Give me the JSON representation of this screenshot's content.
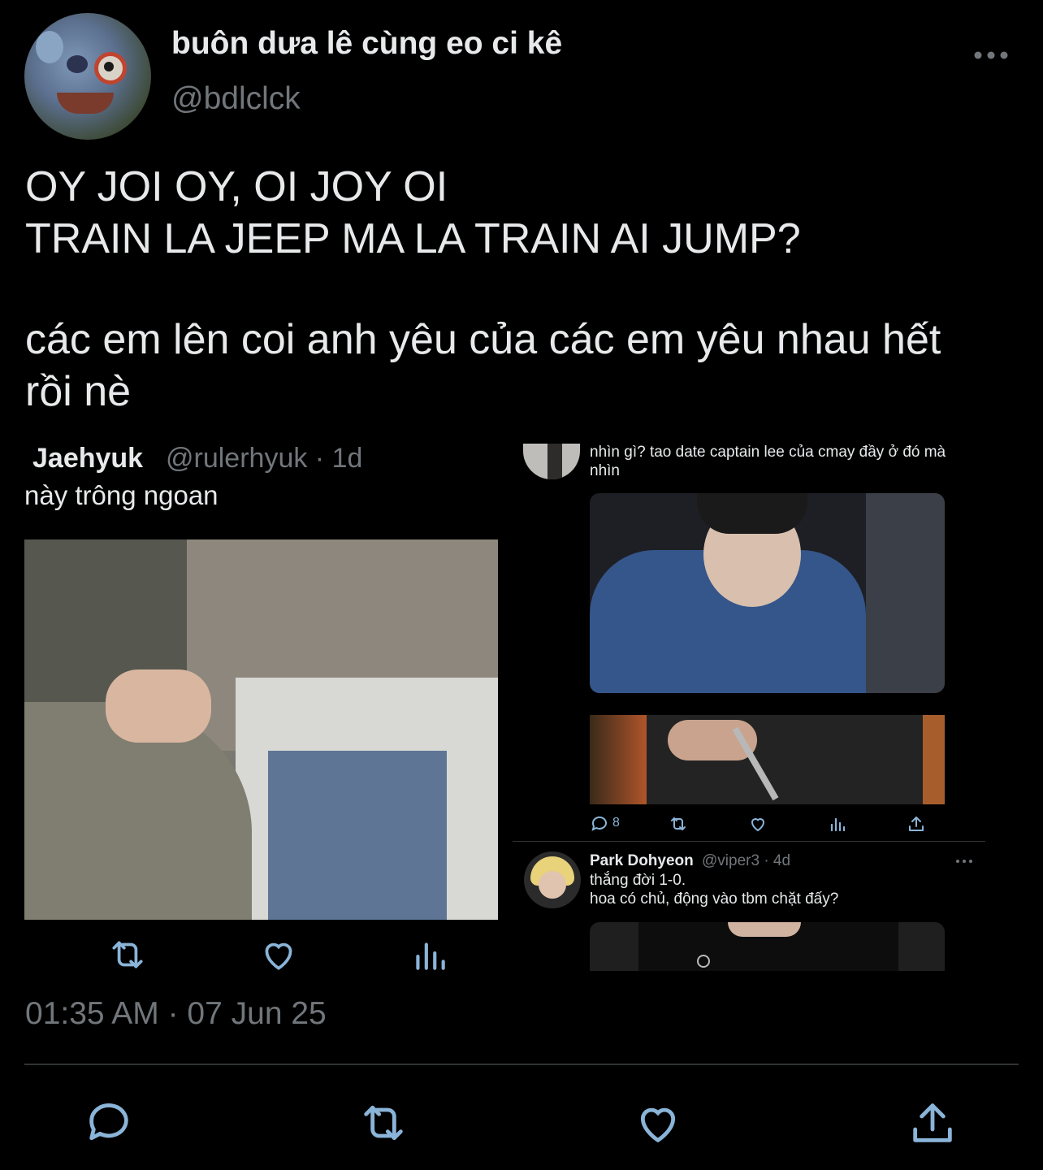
{
  "header": {
    "display_name": "buôn dưa lê cùng eo ci kê",
    "handle": "@bdlclck"
  },
  "tweet": {
    "lines": [
      "OY JOI OY, OI JOY OI",
      "TRAIN LA JEEP MA LA TRAIN AI JUMP?",
      "các em lên coi anh yêu của các em yêu nhau hết",
      "rồi nè"
    ],
    "timestamp": "01:35 AM · 07 Jun 25"
  },
  "embed_left": {
    "name": "Jaehyuk",
    "meta": "@rulerhyuk · 1d",
    "text": "này trông ngoan"
  },
  "embed_right": {
    "reply_text_1": "nhìn gì? tao date captain lee của cmay đầy ở đó mà",
    "reply_text_2": "nhìn",
    "reply_count": "8",
    "second_name": "Park Dohyeon",
    "second_meta": "@viper3 · 4d",
    "second_line_1": "thắng đời 1-0.",
    "second_line_2": "hoa có chủ, động vào tbm chặt đấy?"
  },
  "icons": {
    "more": "more-horizontal-icon",
    "reply": "reply-icon",
    "retweet": "retweet-icon",
    "like": "like-icon",
    "views": "views-icon",
    "share": "share-icon"
  },
  "colors": {
    "background": "#000000",
    "text": "#e7e9ea",
    "secondary": "#71767b",
    "icon": "#8ab4d8",
    "divider": "#2f3336"
  }
}
